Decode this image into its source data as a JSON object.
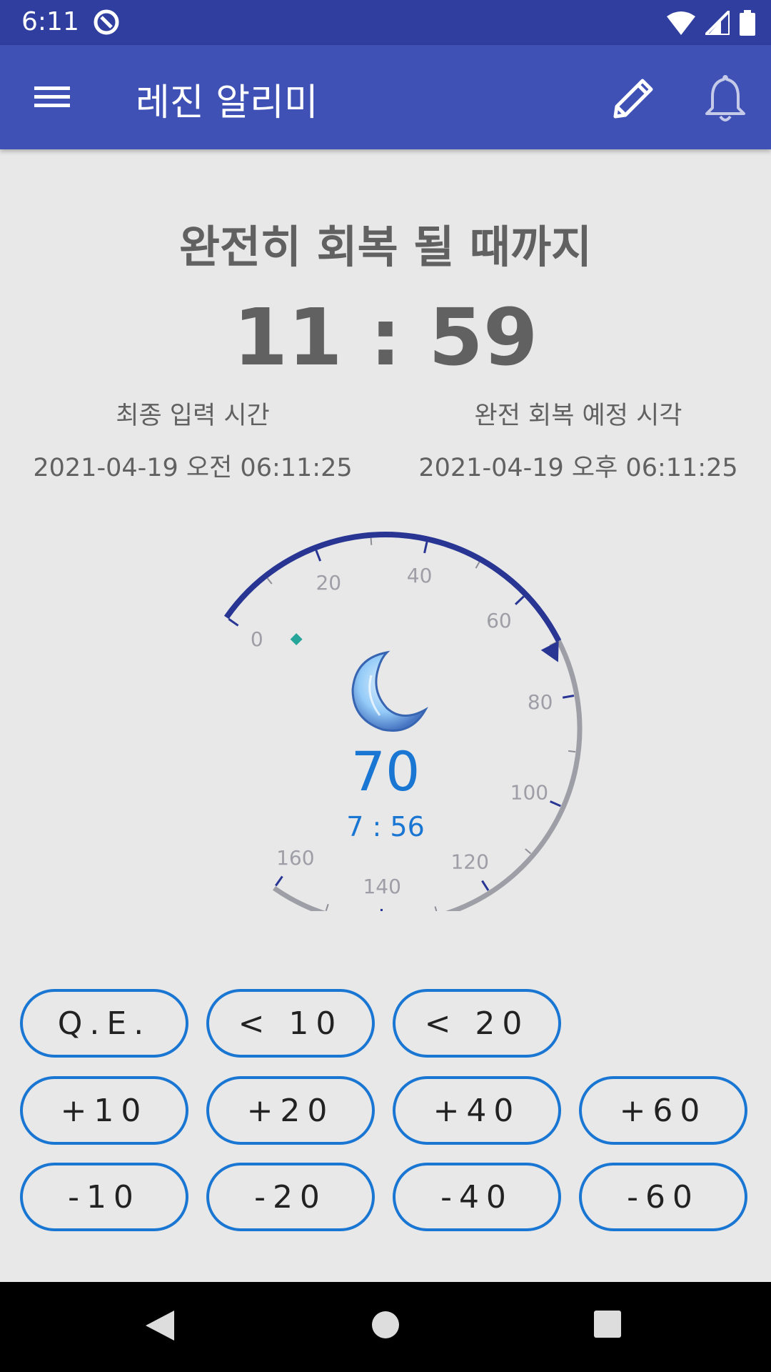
{
  "status": {
    "time": "6:11",
    "icons": [
      "notification-icon",
      "wifi-icon",
      "signal-icon",
      "battery-icon"
    ]
  },
  "app_bar": {
    "title": "레진 알리미",
    "icons": [
      "menu-icon",
      "edit-icon",
      "bell-icon"
    ]
  },
  "main": {
    "heading": "완전히 회복 될 때까지",
    "countdown": "11 : 59",
    "last_input": {
      "label": "최종 입력 시간",
      "value": "2021-04-19 오전 06:11:25"
    },
    "full_recovery": {
      "label": "완전 회복 예정 시각",
      "value": "2021-04-19 오후 06:11:25"
    }
  },
  "gauge": {
    "min": 0,
    "max": 160,
    "value": 70,
    "value_text": "70",
    "sub_text": "7 : 56",
    "tick_labels": [
      "0",
      "20",
      "40",
      "60",
      "80",
      "100",
      "120",
      "140",
      "160"
    ],
    "icon": "moon-icon",
    "colors": {
      "filled": "#283593",
      "track": "#9e9ea6",
      "value_text": "#1976d2",
      "marker": "#26a69a"
    }
  },
  "buttons": {
    "row1": [
      "Q.E.",
      "< 10",
      "< 20"
    ],
    "row2": [
      "+10",
      "+20",
      "+40",
      "+60"
    ],
    "row3": [
      "-10",
      "-20",
      "-40",
      "-60"
    ]
  },
  "nav": {
    "icons": [
      "back-icon",
      "home-icon",
      "recents-icon"
    ]
  },
  "colors": {
    "primary_dark": "#303f9f",
    "primary": "#3f51b5",
    "accent": "#1976d2",
    "background": "#e8e8e9"
  }
}
